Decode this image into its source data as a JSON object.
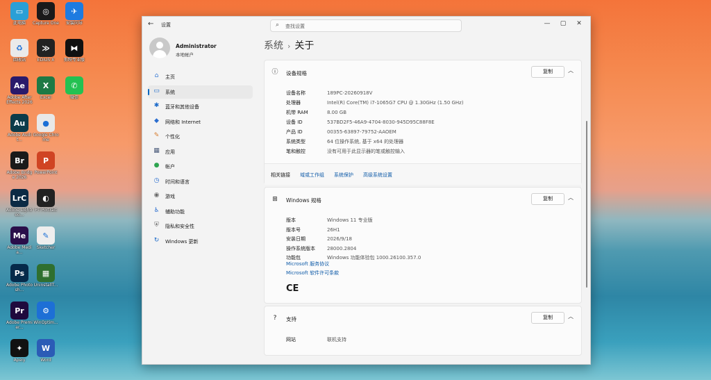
{
  "desktop": {
    "icons": [
      {
        "label": "此电脑",
        "abbr": "▭",
        "color": "#2a9fd6"
      },
      {
        "label": "Capture One",
        "abbr": "◎",
        "color": "#1a1a1a"
      },
      {
        "label": "安装向导",
        "abbr": "✈",
        "color": "#1e7be0"
      },
      {
        "label": "回收站",
        "abbr": "♻",
        "color": "#eaeaea"
      },
      {
        "label": "EDIUS X",
        "abbr": "≫",
        "color": "#222"
      },
      {
        "label": "剪映专业版",
        "abbr": "⧓",
        "color": "#111"
      },
      {
        "label": "Adobe After Effects 2026",
        "abbr": "Ae",
        "color": "#2a1a6b"
      },
      {
        "label": "Excel",
        "abbr": "X",
        "color": "#1d7a45"
      },
      {
        "label": "微信",
        "abbr": "✆",
        "color": "#24c152"
      },
      {
        "label": "Adobe Audit...",
        "abbr": "Au",
        "color": "#0b3b4a"
      },
      {
        "label": "Google Chrome",
        "abbr": "●",
        "color": "#e8e8e8"
      },
      {
        "label": "Adobe Bridge 2026",
        "abbr": "Br",
        "color": "#1a1a1a"
      },
      {
        "label": "PowerPoint",
        "abbr": "P",
        "color": "#d04423"
      },
      {
        "label": "Adobe Lightroo...",
        "abbr": "LrC",
        "color": "#0c2a44"
      },
      {
        "label": "PT Portrait",
        "abbr": "◐",
        "color": "#222"
      },
      {
        "label": "Adobe Media...",
        "abbr": "Me",
        "color": "#2a0e4a"
      },
      {
        "label": "Sketcher",
        "abbr": "✎",
        "color": "#eee"
      },
      {
        "label": "Adobe Photosh...",
        "abbr": "Ps",
        "color": "#062a4a"
      },
      {
        "label": "UninstallT...",
        "abbr": "▦",
        "color": "#2f6f2f"
      },
      {
        "label": "Adobe Premier...",
        "abbr": "Pr",
        "color": "#1f0a3d"
      },
      {
        "label": "WinOptim...",
        "abbr": "⚙",
        "color": "#1d6fd6"
      },
      {
        "label": "Apeiy",
        "abbr": "✦",
        "color": "#111"
      },
      {
        "label": "Word",
        "abbr": "W",
        "color": "#2b5cb6"
      }
    ]
  },
  "window": {
    "app_title": "设置",
    "search_placeholder": "查找设置",
    "controls": {
      "minimize": "—",
      "maximize": "▢",
      "close": "✕"
    },
    "back_icon": "←"
  },
  "user": {
    "name": "Administrator",
    "type": "本地帐户"
  },
  "sidebar": {
    "items": [
      {
        "label": "主页",
        "icon": "⌂",
        "color": "#3a7bd5"
      },
      {
        "label": "系统",
        "icon": "▭",
        "color": "#1b6ac9"
      },
      {
        "label": "蓝牙和其他设备",
        "icon": "✱",
        "color": "#1b6ac9"
      },
      {
        "label": "网络和 Internet",
        "icon": "◆",
        "color": "#2a6dcf"
      },
      {
        "label": "个性化",
        "icon": "✎",
        "color": "#d6792a"
      },
      {
        "label": "应用",
        "icon": "▦",
        "color": "#4a5a7a"
      },
      {
        "label": "帐户",
        "icon": "●",
        "color": "#2ea44f"
      },
      {
        "label": "时间和语言",
        "icon": "◷",
        "color": "#2a6dcf"
      },
      {
        "label": "游戏",
        "icon": "◉",
        "color": "#6a6a6a"
      },
      {
        "label": "辅助功能",
        "icon": "♿",
        "color": "#2a6dcf"
      },
      {
        "label": "隐私和安全性",
        "icon": "⛨",
        "color": "#6a6a6a"
      },
      {
        "label": "Windows 更新",
        "icon": "↻",
        "color": "#1b6ac9"
      }
    ]
  },
  "breadcrumb": {
    "parent": "系统",
    "separator": "›",
    "current": "关于"
  },
  "device_specs": {
    "title": "设备规格",
    "copy": "复制",
    "rows": [
      {
        "k": "设备名称",
        "v": "189PC-20260918V"
      },
      {
        "k": "处理器",
        "v": "Intel(R) Core(TM) i7-1065G7 CPU @ 1.30GHz (1.50 GHz)"
      },
      {
        "k": "机带 RAM",
        "v": "8.00 GB"
      },
      {
        "k": "设备 ID",
        "v": "537BD2F5-46A9-4704-8030-945D95C88F8E"
      },
      {
        "k": "产品 ID",
        "v": "00355-63897-79752-AAOEM"
      },
      {
        "k": "系统类型",
        "v": "64 位操作系统, 基于 x64 的处理器"
      },
      {
        "k": "笔和触控",
        "v": "没有可用于此显示器的笔或触控输入"
      }
    ],
    "related_label": "相关链接",
    "related_links": [
      "域或工作组",
      "系统保护",
      "高级系统设置"
    ]
  },
  "windows_specs": {
    "title": "Windows 规格",
    "copy": "复制",
    "rows": [
      {
        "k": "版本",
        "v": "Windows 11 专业版"
      },
      {
        "k": "版本号",
        "v": "26H1"
      },
      {
        "k": "安装日期",
        "v": "2026/9/18"
      },
      {
        "k": "操作系统版本",
        "v": "28000.2804"
      },
      {
        "k": "功能包",
        "v": "Windows 功能体验包 1000.26100.357.0"
      }
    ],
    "links": [
      "Microsoft 服务协议",
      "Microsoft 软件许可条款"
    ],
    "ce_mark": "CE"
  },
  "support": {
    "title": "支持",
    "copy": "复制",
    "row": {
      "k": "网站",
      "v": "联机支持"
    }
  }
}
